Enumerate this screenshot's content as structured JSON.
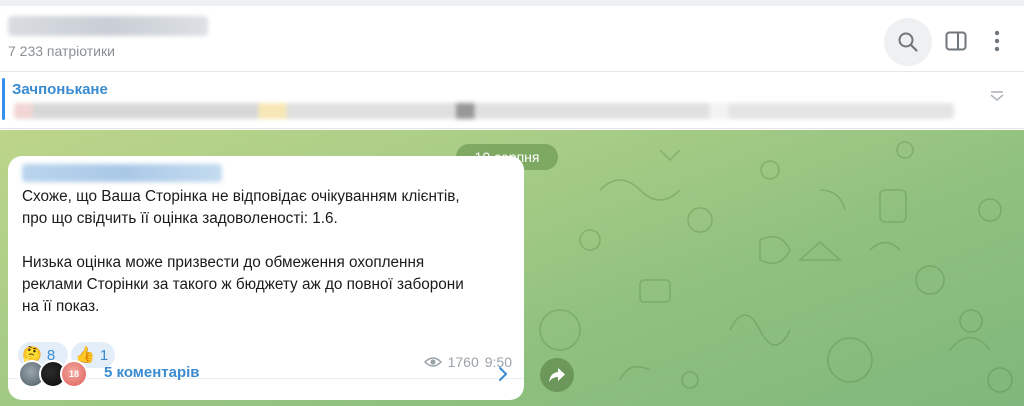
{
  "header": {
    "channel_name": "",
    "subscribers": "7 233 патріотики"
  },
  "pinned": {
    "title": "Зачпонькане",
    "preview": ""
  },
  "chat": {
    "date_badge": "10 серпня",
    "message": {
      "author": "",
      "text": "Схоже, що Ваша Сторінка не відповідає очікуванням клієнтів,\nпро що свідчить її оцінка задоволеності: 1.6.\n\nНизька оцінка може призвести до обмеження охоплення\nреклами Сторінки за такого ж бюджету аж до повної заборони\nна її показ.",
      "reactions": [
        {
          "emoji": "🤔",
          "count": "8"
        },
        {
          "emoji": "👍",
          "count": "1"
        }
      ],
      "views": "1760",
      "time": "9:50",
      "comments": {
        "label": "5 коментарів",
        "avatar_badge": "18"
      }
    }
  },
  "colors": {
    "accent": "#3a8bd0",
    "chat_bg": "#a6cc86",
    "date_badge_bg": "#5c8c46"
  },
  "icons": {
    "search": "search-icon",
    "side_panel": "side-panel-icon",
    "more": "more-vertical-icon",
    "pinned_list": "pinned-list-icon",
    "views": "eye-icon",
    "comments_open": "chevron-right-icon",
    "share": "share-icon"
  }
}
